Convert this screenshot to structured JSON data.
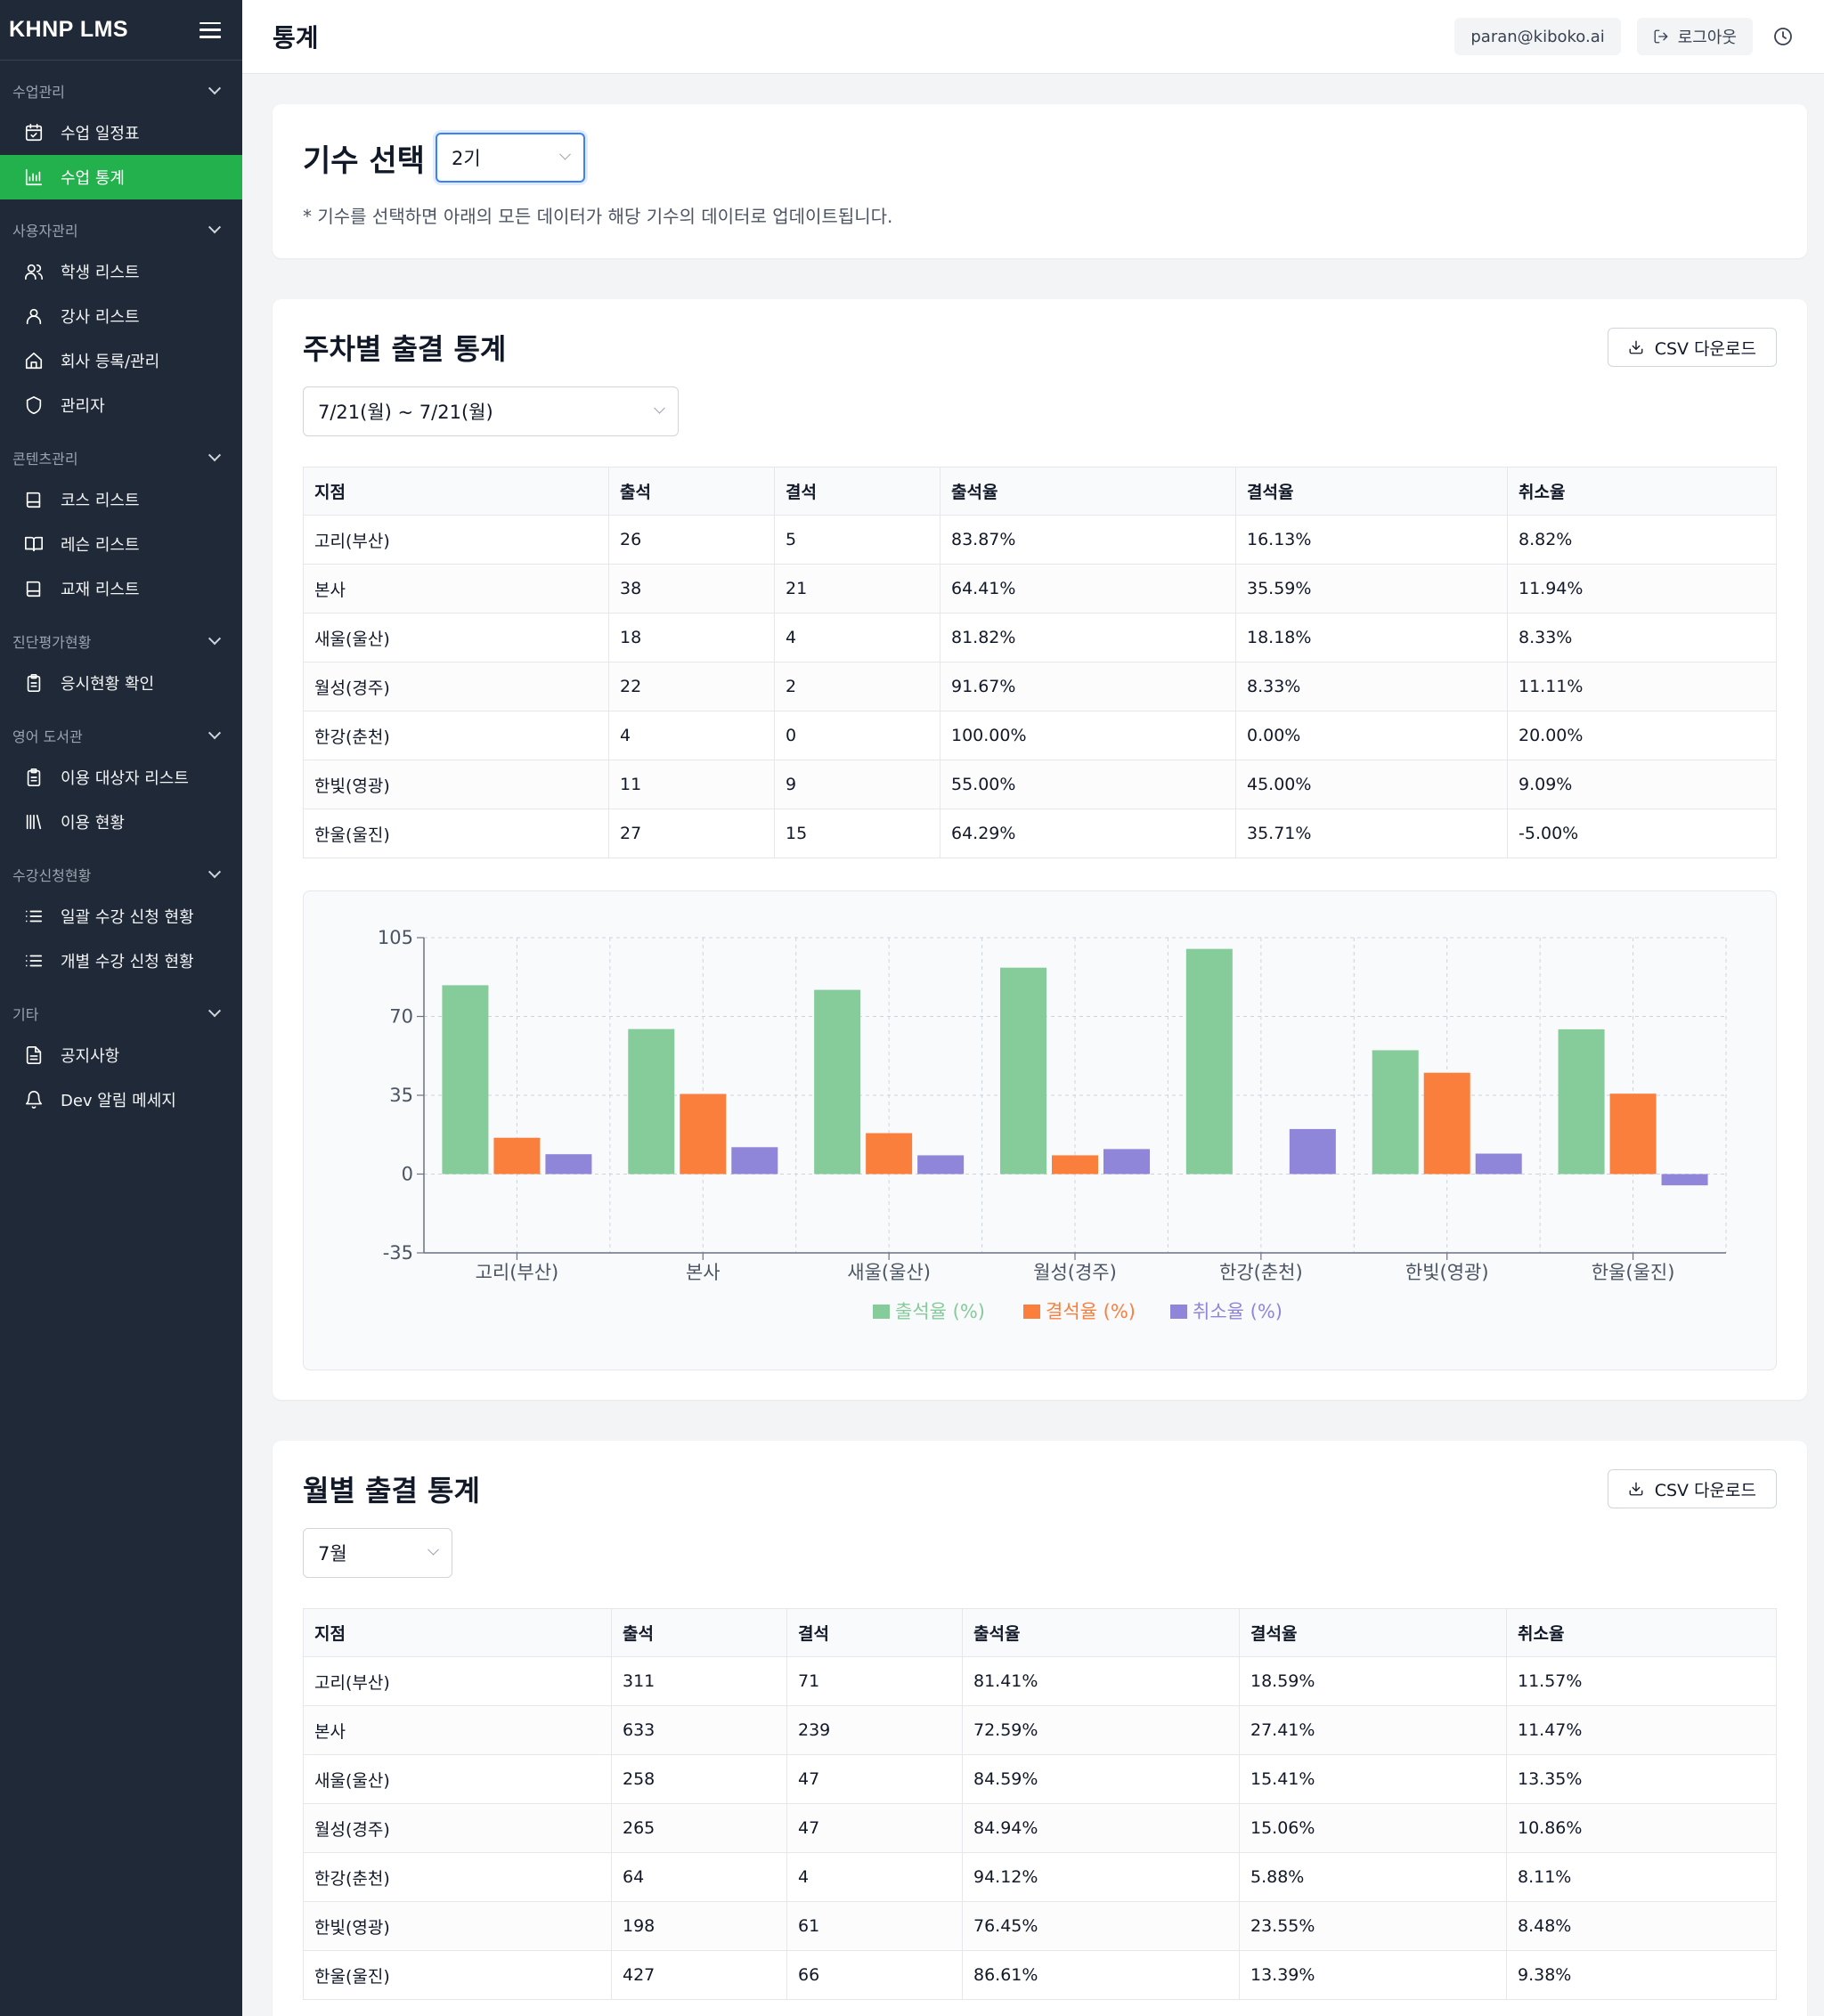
{
  "app": {
    "brand": "KHNP LMS"
  },
  "header": {
    "title": "통계",
    "user_email": "paran@kiboko.ai",
    "logout_label": "로그아웃"
  },
  "sidebar": {
    "sections": [
      {
        "title": "수업관리",
        "items": [
          {
            "label": "수업 일정표",
            "icon": "calendar-check-icon"
          },
          {
            "label": "수업 통계",
            "icon": "chart-icon",
            "active": true
          }
        ]
      },
      {
        "title": "사용자관리",
        "items": [
          {
            "label": "학생 리스트",
            "icon": "users-icon"
          },
          {
            "label": "강사 리스트",
            "icon": "user-icon"
          },
          {
            "label": "회사 등록/관리",
            "icon": "home-icon"
          },
          {
            "label": "관리자",
            "icon": "shield-icon"
          }
        ]
      },
      {
        "title": "콘텐츠관리",
        "items": [
          {
            "label": "코스 리스트",
            "icon": "book-icon"
          },
          {
            "label": "레슨 리스트",
            "icon": "book-open-icon"
          },
          {
            "label": "교재 리스트",
            "icon": "book-icon"
          }
        ]
      },
      {
        "title": "진단평가현황",
        "items": [
          {
            "label": "응시현황 확인",
            "icon": "clipboard-icon"
          }
        ]
      },
      {
        "title": "영어 도서관",
        "items": [
          {
            "label": "이용 대상자 리스트",
            "icon": "clipboard-icon"
          },
          {
            "label": "이용 현황",
            "icon": "library-icon"
          }
        ]
      },
      {
        "title": "수강신청현황",
        "items": [
          {
            "label": "일괄 수강 신청 현황",
            "icon": "list-icon"
          },
          {
            "label": "개별 수강 신청 현황",
            "icon": "list-icon"
          }
        ]
      },
      {
        "title": "기타",
        "items": [
          {
            "label": "공지사항",
            "icon": "file-text-icon"
          },
          {
            "label": "Dev 알림 메세지",
            "icon": "bell-icon"
          }
        ]
      }
    ]
  },
  "cohort": {
    "label": "기수 선택",
    "selected": "2기",
    "hint": "* 기수를 선택하면 아래의 모든 데이터가 해당 기수의 데이터로 업데이트됩니다."
  },
  "weekly": {
    "title": "주차별 출결 통계",
    "csv_label": "CSV 다운로드",
    "week_selected": "7/21(월) ~ 7/21(월)",
    "columns": [
      "지점",
      "출석",
      "결석",
      "출석율",
      "결석율",
      "취소율"
    ],
    "rows": [
      [
        "고리(부산)",
        "26",
        "5",
        "83.87%",
        "16.13%",
        "8.82%"
      ],
      [
        "본사",
        "38",
        "21",
        "64.41%",
        "35.59%",
        "11.94%"
      ],
      [
        "새울(울산)",
        "18",
        "4",
        "81.82%",
        "18.18%",
        "8.33%"
      ],
      [
        "월성(경주)",
        "22",
        "2",
        "91.67%",
        "8.33%",
        "11.11%"
      ],
      [
        "한강(춘천)",
        "4",
        "0",
        "100.00%",
        "0.00%",
        "20.00%"
      ],
      [
        "한빛(영광)",
        "11",
        "9",
        "55.00%",
        "45.00%",
        "9.09%"
      ],
      [
        "한울(울진)",
        "27",
        "15",
        "64.29%",
        "35.71%",
        "-5.00%"
      ]
    ]
  },
  "monthly": {
    "title": "월별 출결 통계",
    "csv_label": "CSV 다운로드",
    "month_selected": "7월",
    "columns": [
      "지점",
      "출석",
      "결석",
      "출석율",
      "결석율",
      "취소율"
    ],
    "rows": [
      [
        "고리(부산)",
        "311",
        "71",
        "81.41%",
        "18.59%",
        "11.57%"
      ],
      [
        "본사",
        "633",
        "239",
        "72.59%",
        "27.41%",
        "11.47%"
      ],
      [
        "새울(울산)",
        "258",
        "47",
        "84.59%",
        "15.41%",
        "13.35%"
      ],
      [
        "월성(경주)",
        "265",
        "47",
        "84.94%",
        "15.06%",
        "10.86%"
      ],
      [
        "한강(춘천)",
        "64",
        "4",
        "94.12%",
        "5.88%",
        "8.11%"
      ],
      [
        "한빛(영광)",
        "198",
        "61",
        "76.45%",
        "23.55%",
        "8.48%"
      ],
      [
        "한울(울진)",
        "427",
        "66",
        "86.61%",
        "13.39%",
        "9.38%"
      ]
    ]
  },
  "chart_data": {
    "type": "bar",
    "categories": [
      "고리(부산)",
      "본사",
      "새울(울산)",
      "월성(경주)",
      "한강(춘천)",
      "한빛(영광)",
      "한울(울진)"
    ],
    "series": [
      {
        "name": "출석율 (%)",
        "color": "#86cb9a",
        "values": [
          83.87,
          64.41,
          81.82,
          91.67,
          100.0,
          55.0,
          64.29
        ]
      },
      {
        "name": "결석율 (%)",
        "color": "#fb7f3c",
        "values": [
          16.13,
          35.59,
          18.18,
          8.33,
          0.0,
          45.0,
          35.71
        ]
      },
      {
        "name": "취소율 (%)",
        "color": "#8f86da",
        "values": [
          8.82,
          11.94,
          8.33,
          11.11,
          20.0,
          9.09,
          -5.0
        ]
      }
    ],
    "ylim": [
      -35,
      105
    ],
    "yticks": [
      "105",
      "70",
      "35",
      "0",
      "-35"
    ],
    "grid": true,
    "legend": "bottom"
  }
}
